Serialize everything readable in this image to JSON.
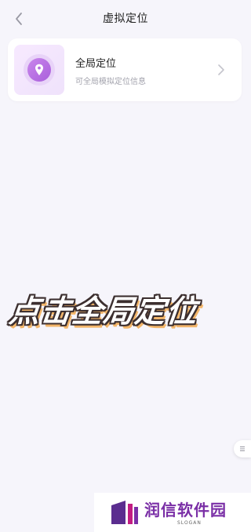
{
  "header": {
    "title": "虚拟定位",
    "back_icon": "chevron-left-icon"
  },
  "card": {
    "title": "全局定位",
    "subtitle": "可全局模拟定位信息",
    "icon": "location-pin-icon",
    "arrow_icon": "chevron-right-icon",
    "accent_color": "#b56fe0"
  },
  "overlay": {
    "text": "点击全局定位"
  },
  "float_handle": {
    "icon": "menu-lines-icon"
  },
  "watermark": {
    "name": "润信软件园",
    "slogan": "SLOGAN"
  }
}
